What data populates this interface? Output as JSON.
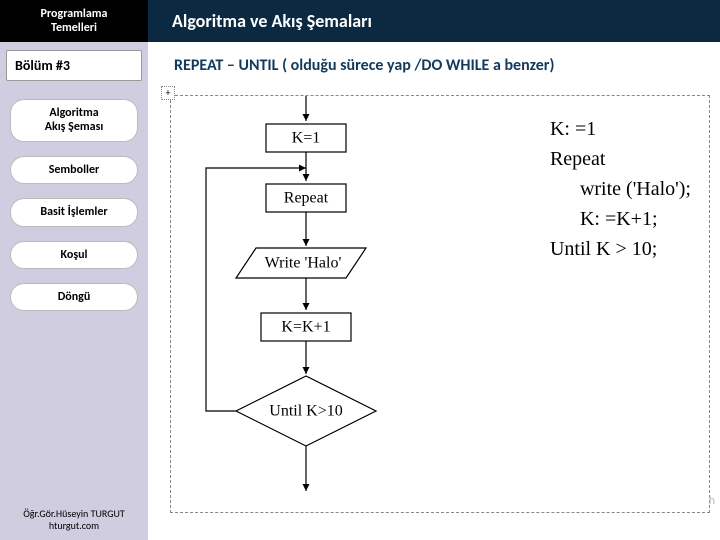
{
  "header": {
    "left_line1": "Programlama",
    "left_line2": "Temelleri",
    "title": "Algoritma ve Akış Şemaları"
  },
  "sidebar": {
    "chapter": "Bölüm #3",
    "items": [
      {
        "label": "Algoritma\nAkış Şeması"
      },
      {
        "label": "Semboller"
      },
      {
        "label": "Basit İşlemler"
      },
      {
        "label": "Koşul"
      },
      {
        "label": "Döngü"
      }
    ],
    "footer_line1": "Öğr.Gör.Hüseyin TURGUT",
    "footer_line2": "hturgut.com"
  },
  "content": {
    "subtitle": "REPEAT – UNTIL  ( olduğu sürece yap /DO WHILE a benzer)",
    "plus": "+"
  },
  "flowchart": {
    "assign": "K=1",
    "repeat": "Repeat",
    "action": "Write 'Halo'",
    "increment": "K=K+1",
    "condition": "Until K>10"
  },
  "pseudocode": {
    "l1": "K: =1",
    "l2": "Repeat",
    "l3": "write ('Halo');",
    "l4": "K: =K+1;",
    "l5": "Until K > 10;"
  },
  "watermark": "h"
}
